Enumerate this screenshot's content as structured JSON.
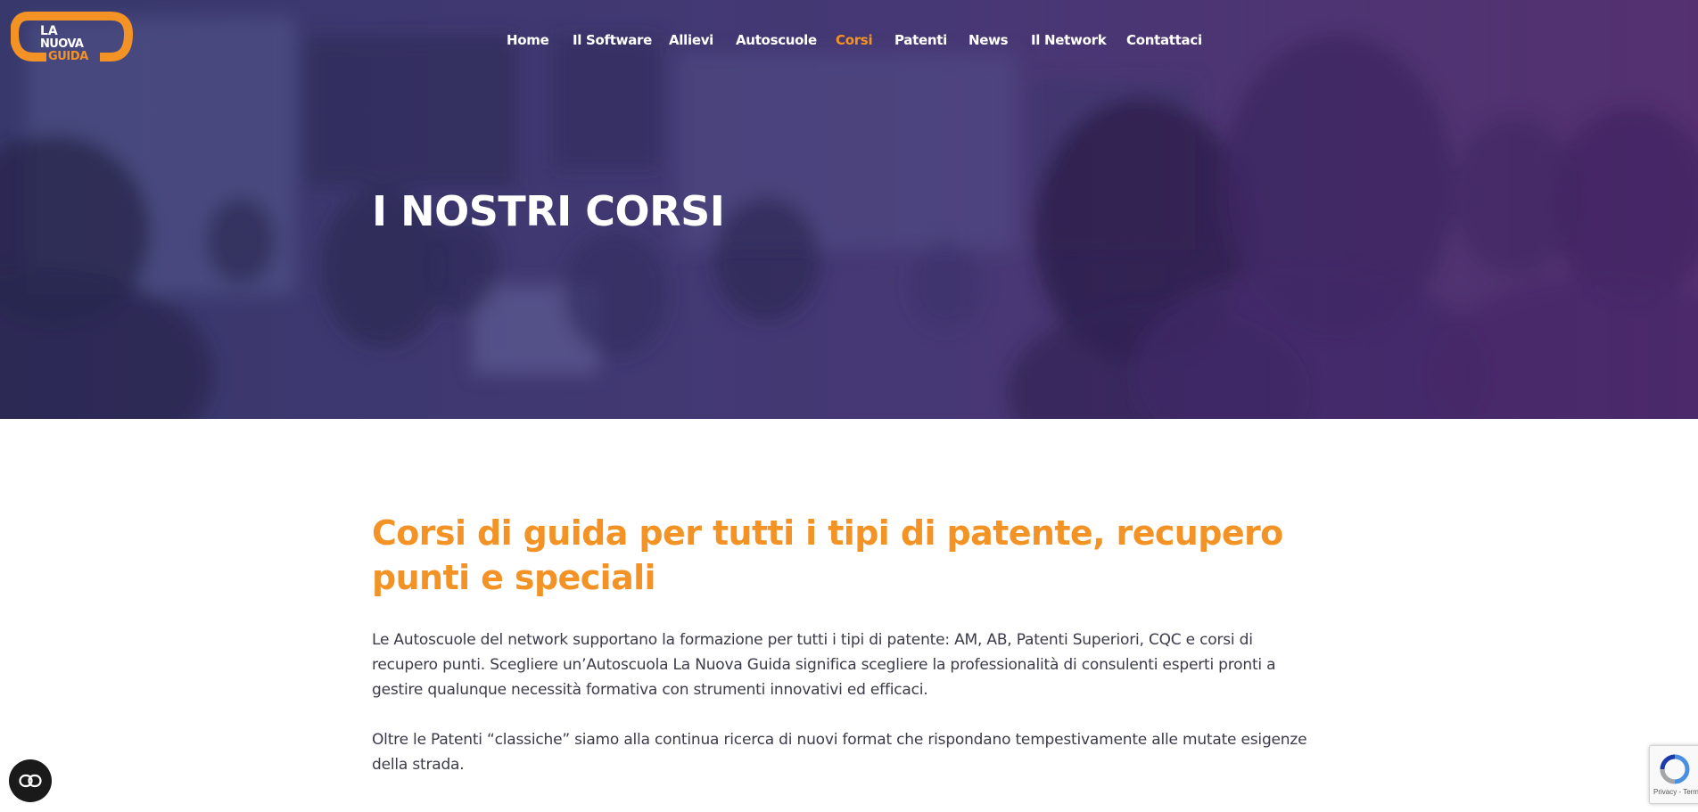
{
  "brand": {
    "logo_text": [
      "LA",
      "NUOVA",
      "GUIDA"
    ],
    "accent_color": "#f39325",
    "hero_tint": "#3d3468"
  },
  "nav": {
    "items": [
      {
        "label": "Home"
      },
      {
        "label": "Il Software"
      },
      {
        "label": "Allievi"
      },
      {
        "label": "Autoscuole"
      },
      {
        "label": "Corsi",
        "active": true
      },
      {
        "label": "Patenti"
      },
      {
        "label": "News"
      },
      {
        "label": "Il Network"
      },
      {
        "label": "Contattaci"
      }
    ]
  },
  "hero": {
    "title": "I NOSTRI CORSI"
  },
  "main": {
    "heading_line1": "Corsi di guida per tutti i tipi di patente, recupero",
    "heading_line2": "punti e speciali",
    "paragraph1": "Le Autoscuole del network supportano la formazione per tutti i tipi di patente: AM, AB, Patenti Superiori, CQC e corsi di recupero punti. Scegliere un’Autoscuola La Nuova Guida significa scegliere la professionalità di consulenti esperti pronti a gestire qualunque necessità formativa con strumenti innovativi ed efficaci.",
    "paragraph2": "Oltre le Patenti “classiche” siamo alla continua ricerca di nuovi format che rispondano tempestivamente alle mutate esigenze della strada."
  },
  "widgets": {
    "accessibility_icon": "accessibility-toggle-icon",
    "recaptcha_text": "Privacy - Termini",
    "recaptcha_icon": "recaptcha-icon"
  }
}
